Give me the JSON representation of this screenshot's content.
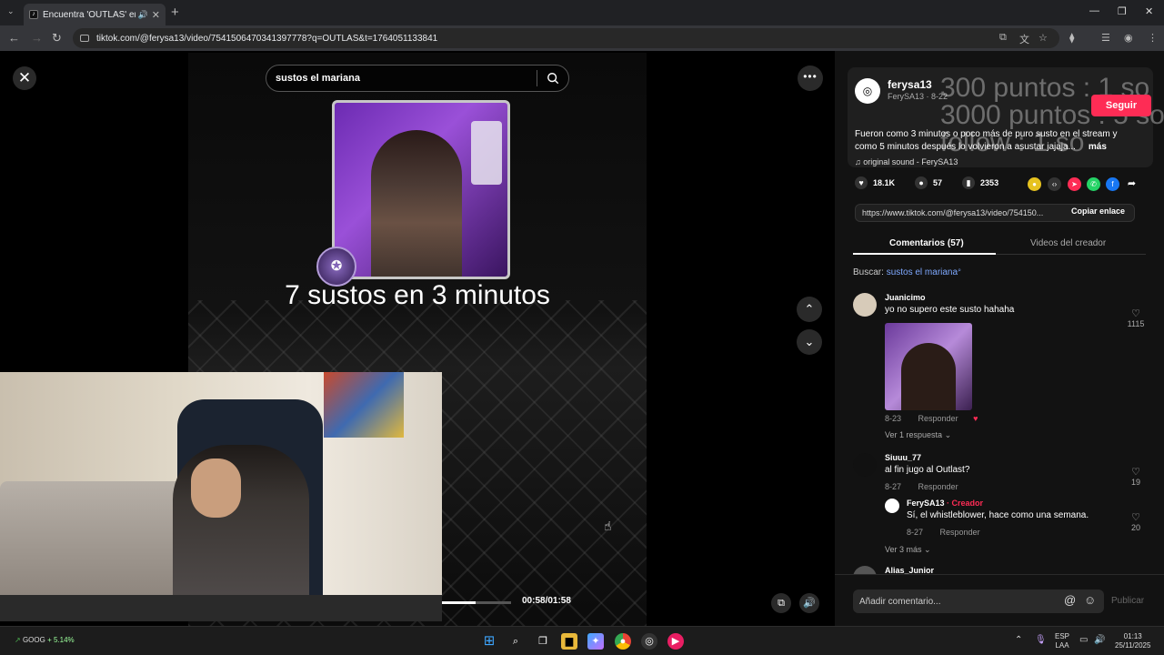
{
  "browser": {
    "tab_title": "Encuentra 'OUTLAS' en Tik",
    "url": "tiktok.com/@ferysa13/video/7541506470341397778?q=OUTLAS&t=1764051133841"
  },
  "video": {
    "search_query": "sustos el mariana",
    "caption": "7 sustos en 3 minutos",
    "time": "00:58/01:58",
    "progress": 0.49
  },
  "author": {
    "name": "ferysa13",
    "sub": "FerySA13 · 8-22",
    "follow_label": "Seguir",
    "overlay_text": "300 puntos : 1 so\n3000 puntos : 5 so\nfollow : 1 so",
    "description": "Fueron como 3 minutos o poco más de puro susto en el stream y como 5 minutos después lo volvieron a asustar jajaja...",
    "more_label": "más",
    "music": "original sound - FerySA13"
  },
  "stats": {
    "likes": "18.1K",
    "comments": "57",
    "saves": "2353"
  },
  "share": {
    "link": "https://www.tiktok.com/@ferysa13/video/754150...",
    "copy_label": "Copiar enlace"
  },
  "tabs": {
    "comments": "Comentarios (57)",
    "creator_videos": "Videos del creador"
  },
  "search_hint": {
    "prefix": "Buscar:",
    "keyword": "sustos el mariana"
  },
  "comments": [
    {
      "user": "Juanicimo",
      "text": "yo no supero este susto hahaha",
      "date": "8-23",
      "reply": "Responder",
      "likes": "1115",
      "replies": "Ver 1 respuesta"
    },
    {
      "user": "Siuuu_77",
      "text": "al fin jugo al Outlast?",
      "date": "8-27",
      "reply": "Responder",
      "likes": "19"
    },
    {
      "user": "FerySA13",
      "badge": "· Creador",
      "text": "Sí, el whistleblower, hace como una semana.",
      "date": "8-27",
      "reply": "Responder",
      "likes": "20",
      "replies": "Ver 3 más"
    },
    {
      "user": "Alias_Junior"
    }
  ],
  "comment_box": {
    "placeholder": "Añadir comentario...",
    "publish": "Publicar"
  },
  "taskbar": {
    "stock_name": "GOOG",
    "stock_change": "+ 5.14%",
    "lang": "ESP",
    "lang2": "LAA",
    "time": "01:13",
    "date": "25/11/2025"
  }
}
